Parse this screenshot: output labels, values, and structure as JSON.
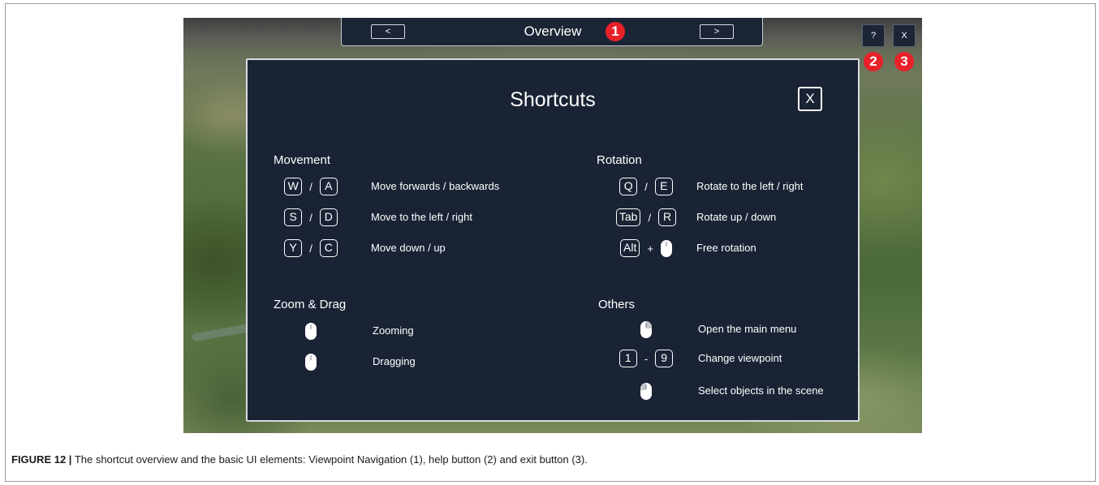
{
  "viewpoint_nav": {
    "prev_label": "<",
    "title": "Overview",
    "next_label": ">"
  },
  "corner_buttons": {
    "help_label": "?",
    "exit_label": "X"
  },
  "callouts": [
    "1",
    "2",
    "3"
  ],
  "panel": {
    "title": "Shortcuts",
    "close_label": "X",
    "sections": {
      "movement": {
        "title": "Movement",
        "rows": [
          {
            "key1": "W",
            "sep": "/",
            "key2": "A",
            "desc": "Move forwards / backwards"
          },
          {
            "key1": "S",
            "sep": "/",
            "key2": "D",
            "desc": "Move to the left / right"
          },
          {
            "key1": "Y",
            "sep": "/",
            "key2": "C",
            "desc": "Move down / up"
          }
        ]
      },
      "rotation": {
        "title": "Rotation",
        "rows": [
          {
            "key1": "Q",
            "sep": "/",
            "key2": "E",
            "desc": "Rotate to the left / right"
          },
          {
            "key1": "Tab",
            "sep": "/",
            "key2": "R",
            "desc": "Rotate up / down"
          },
          {
            "key1": "Alt",
            "sep": "+",
            "icon": "mouse-icon",
            "desc": "Free rotation"
          }
        ]
      },
      "zoom_drag": {
        "title": "Zoom & Drag",
        "rows": [
          {
            "icon": "mouse-wheel-icon",
            "desc": "Zooming"
          },
          {
            "icon": "mouse-wheel-icon",
            "desc": "Dragging"
          }
        ]
      },
      "others": {
        "title": "Others",
        "rows": [
          {
            "icon": "mouse-right-click-icon",
            "desc": "Open the main menu"
          },
          {
            "key1": "1",
            "sep": "-",
            "key2": "9",
            "desc": "Change viewpoint"
          },
          {
            "icon": "mouse-left-click-icon",
            "desc": "Select objects in the scene"
          }
        ]
      }
    }
  },
  "caption": {
    "label": "FIGURE 12 |",
    "text": " The shortcut overview and the basic UI elements: Viewpoint Navigation (1), help button (2) and exit button (3)."
  },
  "colors": {
    "panel_bg": "#1a2334",
    "callout_red": "#e8202a",
    "text": "#ffffff"
  }
}
